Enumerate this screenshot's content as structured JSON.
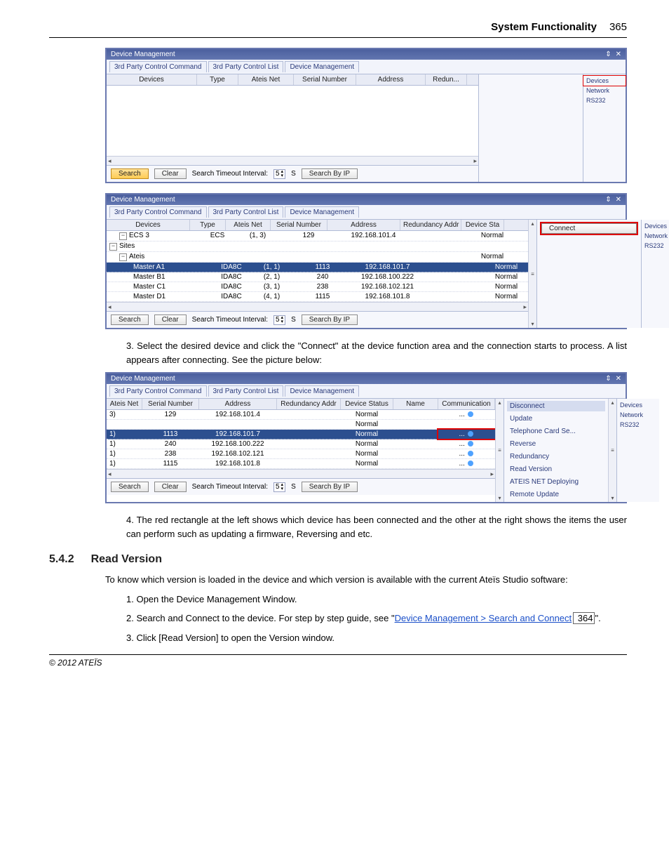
{
  "header": {
    "title": "System Functionality",
    "page_number": "365"
  },
  "panel_common": {
    "title": "Device Management",
    "tabs": [
      "3rd Party Control Command",
      "3rd Party Control List",
      "Device Management"
    ],
    "sidebar": {
      "devices": "Devices",
      "network": "Network",
      "rs232": "RS232"
    },
    "footer": {
      "search": "Search",
      "clear": "Clear",
      "timeout_label": "Search Timeout Interval:",
      "timeout_value": "5",
      "timeout_unit": "S",
      "search_by_ip": "Search By IP"
    }
  },
  "panel1": {
    "columns": [
      "Devices",
      "Type",
      "Ateis Net",
      "Serial Number",
      "Address",
      "Redun..."
    ]
  },
  "panel2": {
    "columns": [
      "Devices",
      "Type",
      "Ateis Net",
      "Serial Number",
      "Address",
      "Redundancy Addr",
      "Device Sta"
    ],
    "connect_label": "Connect",
    "rows": [
      {
        "dev": "ECS 3",
        "type": "ECS",
        "anet": "(1, 3)",
        "sn": "129",
        "addr": "192.168.101.4",
        "ra": "",
        "st": "Normal",
        "tree": 1
      },
      {
        "dev": "Sites",
        "type": "",
        "anet": "",
        "sn": "",
        "addr": "",
        "ra": "",
        "st": "",
        "tree": 0
      },
      {
        "dev": "Ateis",
        "type": "",
        "anet": "",
        "sn": "",
        "addr": "",
        "ra": "",
        "st": "Normal",
        "tree": 1
      },
      {
        "dev": "Master A1",
        "type": "IDA8C",
        "anet": "(1, 1)",
        "sn": "1113",
        "addr": "192.168.101.7",
        "ra": "",
        "st": "Normal",
        "tree": 2,
        "sel": true
      },
      {
        "dev": "Master B1",
        "type": "IDA8C",
        "anet": "(2, 1)",
        "sn": "240",
        "addr": "192.168.100.222",
        "ra": "",
        "st": "Normal",
        "tree": 2
      },
      {
        "dev": "Master C1",
        "type": "IDA8C",
        "anet": "(3, 1)",
        "sn": "238",
        "addr": "192.168.102.121",
        "ra": "",
        "st": "Normal",
        "tree": 2
      },
      {
        "dev": "Master D1",
        "type": "IDA8C",
        "anet": "(4, 1)",
        "sn": "1115",
        "addr": "192.168.101.8",
        "ra": "",
        "st": "Normal",
        "tree": 2
      }
    ]
  },
  "text_step3": "3. Select the desired device and click the \"Connect\" at the device function area and the connection starts to process. A list appears after connecting. See the picture below:",
  "panel3": {
    "columns": [
      "Ateis Net",
      "Serial Number",
      "Address",
      "Redundancy Addr",
      "Device Status",
      "Name",
      "Communication"
    ],
    "rows": [
      {
        "anet": "3)",
        "sn": "129",
        "addr": "192.168.101.4",
        "ra": "",
        "st": "Normal",
        "name": "",
        "comm": "..."
      },
      {
        "anet": "",
        "sn": "",
        "addr": "",
        "ra": "",
        "st": "Normal",
        "name": "",
        "comm": ""
      },
      {
        "anet": "1)",
        "sn": "1113",
        "addr": "192.168.101.7",
        "ra": "",
        "st": "Normal",
        "name": "",
        "comm": "...",
        "sel": true
      },
      {
        "anet": "1)",
        "sn": "240",
        "addr": "192.168.100.222",
        "ra": "",
        "st": "Normal",
        "name": "",
        "comm": "..."
      },
      {
        "anet": "1)",
        "sn": "238",
        "addr": "192.168.102.121",
        "ra": "",
        "st": "Normal",
        "name": "",
        "comm": "..."
      },
      {
        "anet": "1)",
        "sn": "1115",
        "addr": "192.168.101.8",
        "ra": "",
        "st": "Normal",
        "name": "",
        "comm": "..."
      }
    ],
    "actions": [
      "Disconnect",
      "Update",
      "Telephone Card Se...",
      "Reverse",
      "Redundancy",
      "Read Version",
      "ATEIS NET Deploying",
      "Remote Update"
    ]
  },
  "text_step4": "4. The red rectangle at the left shows which device has been connected and the other at the right shows the items the user can perform such as updating a firmware, Reversing and etc.",
  "section": {
    "num": "5.4.2",
    "title": "Read Version"
  },
  "section_intro": "To know which version is loaded in the device and which version is available with the current Ateïs Studio software:",
  "section_steps": {
    "s1": "1. Open the Device Management Window.",
    "s2a": "2. Search and Connect to the device. For step by step guide, see \"",
    "s2_link": "Device Management > Search and Connect",
    "s2_ref": " 364",
    "s2b": "\".",
    "s3": "3. Click [Read Version] to open the Version window."
  },
  "footer_text": "© 2012 ATEÏS"
}
